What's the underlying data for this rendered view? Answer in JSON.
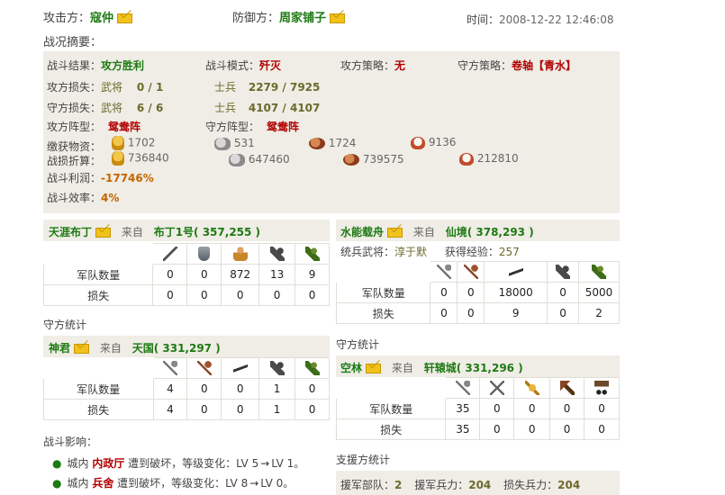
{
  "header": {
    "attacker_label": "攻击方：",
    "attacker_name": "寇仲",
    "defender_label": "防御方：",
    "defender_name": "周家铺子",
    "time_label": "时间：",
    "time_value": "2008-12-22 12:46:08",
    "summary_title": "战况摘要："
  },
  "summary": {
    "result_label": "战斗结果：",
    "result_value": "攻方胜利",
    "mode_label": "战斗模式：",
    "mode_value": "歼灭",
    "atk_strategy_label": "攻方策略：",
    "atk_strategy_value": "无",
    "def_strategy_label": "守方策略：",
    "def_strategy_value": "卷轴【青水】",
    "atk_loss_label": "攻方损失：",
    "atk_general_label": "武将",
    "atk_general_value": "0 / 1",
    "atk_soldier_label": "士兵",
    "atk_soldier_value": "2279 / 7925",
    "def_loss_label": "守方损失：",
    "def_general_label": "武将",
    "def_general_value": "6 / 6",
    "def_soldier_label": "士兵",
    "def_soldier_value": "4107 / 4107",
    "atk_formation_label": "攻方阵型：",
    "atk_formation_value": "鸳鸯阵",
    "def_formation_label": "守方阵型：",
    "def_formation_value": "鸳鸯阵",
    "loot_label": "缴获物资：",
    "loot": [
      "1702",
      "531",
      "1724",
      "9136"
    ],
    "loss_conv_label": "战损折算：",
    "loss_conv": [
      "736840",
      "647460",
      "739575",
      "212810"
    ],
    "profit_label": "战斗利润：",
    "profit_value": "-17746%",
    "efficiency_label": "战斗效率：",
    "efficiency_value": "4%",
    "resource_icons": [
      "gold-icon",
      "stone-icon",
      "meat-icon",
      "rice-icon"
    ]
  },
  "left_panel1": {
    "player": "天涯布丁",
    "from_label": "来自",
    "city": "布丁1号",
    "coords": "( 357,255 )",
    "row_labels": [
      "军队数量",
      "损失"
    ],
    "units": [
      "spear-icon",
      "shield-icon",
      "archer-icon",
      "cavalry-icon",
      "green-cavalry-icon"
    ],
    "counts": [
      "0",
      "0",
      "872",
      "13",
      "9"
    ],
    "losses": [
      "0",
      "0",
      "0",
      "0",
      "0"
    ]
  },
  "defense_stats_label": "守方统计",
  "left_panel2": {
    "player": "神君",
    "from_label": "来自",
    "city": "天国",
    "coords": "( 331,297 )",
    "row_labels": [
      "军队数量",
      "损失"
    ],
    "units": [
      "scythe-icon",
      "axe-icon",
      "blade-icon",
      "cavalry-icon",
      "green-cavalry-icon"
    ],
    "counts": [
      "4",
      "0",
      "0",
      "1",
      "0"
    ],
    "losses": [
      "4",
      "0",
      "0",
      "1",
      "0"
    ]
  },
  "right_panel1": {
    "player": "水能载舟",
    "from_label": "来自",
    "city": "仙境",
    "coords": "( 378,293 )",
    "general_label": "统兵武将：",
    "general_value": "淳于默",
    "exp_label": "获得经验：",
    "exp_value": "257",
    "row_labels": [
      "军队数量",
      "损失"
    ],
    "units": [
      "scythe-icon",
      "axe-icon",
      "blade-icon",
      "cavalry-icon",
      "green-cavalry-icon"
    ],
    "counts": [
      "0",
      "0",
      "18000",
      "0",
      "5000"
    ],
    "losses": [
      "0",
      "0",
      "9",
      "0",
      "2"
    ]
  },
  "right_defense_stats_label": "守方统计",
  "right_panel2": {
    "player": "空林",
    "from_label": "来自",
    "city": "轩辕城",
    "coords": "( 331,296 )",
    "row_labels": [
      "军队数量",
      "损失"
    ],
    "units": [
      "scythe-icon",
      "sword-icon",
      "gold-weapon-icon",
      "horse-icon",
      "cart-icon"
    ],
    "counts": [
      "35",
      "0",
      "0",
      "0",
      "0"
    ],
    "losses": [
      "35",
      "0",
      "0",
      "0",
      "0"
    ]
  },
  "impact": {
    "title": "战斗影响：",
    "items": [
      {
        "prefix": "城内",
        "building": "内政厅",
        "text": "遭到破坏，等级变化：LV 5",
        "to": "LV 1。"
      },
      {
        "prefix": "城内",
        "building": "兵舍",
        "text": "遭到破坏，等级变化：LV 8",
        "to": "LV 0。"
      }
    ]
  },
  "support": {
    "title": "支援方统计",
    "troops_label": "援军部队：",
    "troops_value": "2",
    "force_label": "援军兵力：",
    "force_value": "204",
    "loss_label": "损失兵力：",
    "loss_value": "204"
  }
}
